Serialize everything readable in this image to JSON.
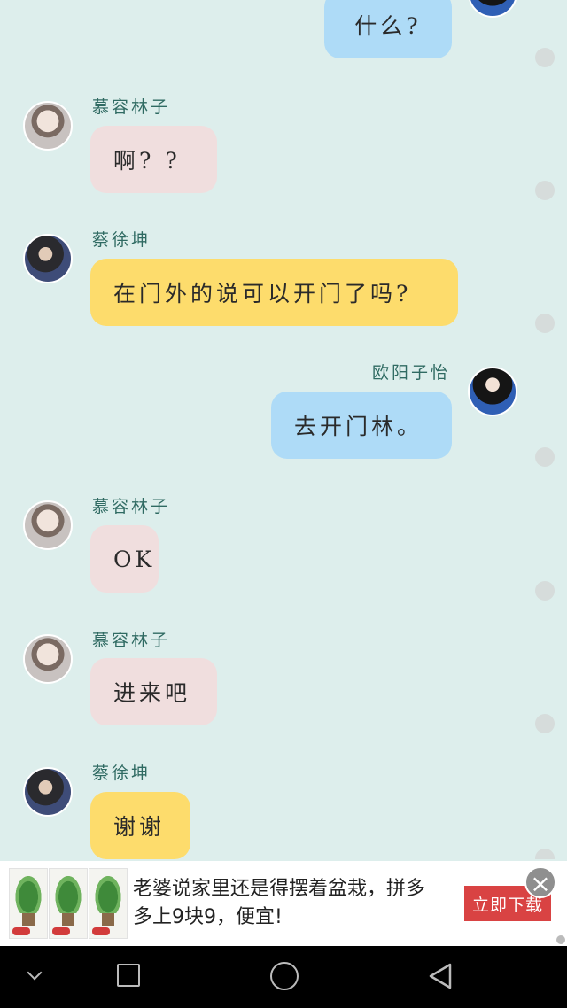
{
  "messages": [
    {
      "side": "right",
      "sender": "",
      "text": "什么?"
    },
    {
      "side": "left",
      "sender": "慕容林子",
      "text": "啊? ?"
    },
    {
      "side": "left",
      "sender": "蔡徐坤",
      "text": "在门外的说可以开门了吗?"
    },
    {
      "side": "right",
      "sender": "欧阳子怡",
      "text": "去开门林。"
    },
    {
      "side": "left",
      "sender": "慕容林子",
      "text": "OK"
    },
    {
      "side": "left",
      "sender": "慕容林子",
      "text": "进来吧"
    },
    {
      "side": "left",
      "sender": "蔡徐坤",
      "text": "谢谢"
    }
  ],
  "ad": {
    "text": "老婆说家里还是得摆着盆栽，拼多多上9块9，便宜!",
    "button": "立即下载",
    "close_icon": "close-icon"
  },
  "navbar": {
    "icons": [
      "chevron-down-icon",
      "recent-apps-icon",
      "home-icon",
      "back-icon"
    ]
  },
  "colors": {
    "background": "#ddeeec",
    "bubble_pink": "#f0dede",
    "bubble_yellow": "#fddc6c",
    "bubble_blue": "#aedbf7",
    "name_color": "#2f6a62",
    "ad_button": "#d94343"
  }
}
